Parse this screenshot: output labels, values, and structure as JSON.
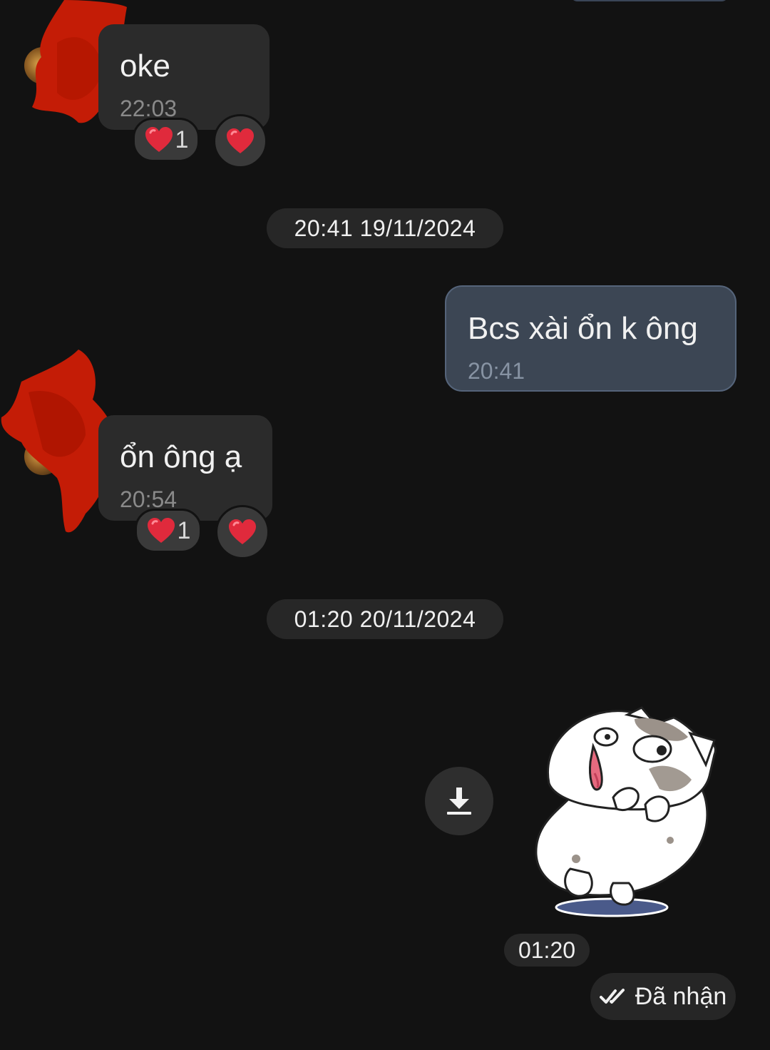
{
  "colors": {
    "background": "#121212",
    "bubble_incoming": "#2b2b2b",
    "bubble_outgoing": "#3c4654",
    "chip": "#272727",
    "reaction_heart": "#e02a3c"
  },
  "messages": [
    {
      "direction": "incoming",
      "text": "oke",
      "time": "22:03",
      "reaction": {
        "icon": "heart-icon",
        "count": "1"
      }
    },
    {
      "direction": "outgoing",
      "text": "Bcs xài ổn k ông",
      "time": "20:41"
    },
    {
      "direction": "incoming",
      "text": "ổn ông ạ",
      "time": "20:54",
      "reaction": {
        "icon": "heart-icon",
        "count": "1"
      }
    },
    {
      "direction": "outgoing",
      "type": "sticker",
      "sticker": "cat-sticker",
      "time": "01:20"
    }
  ],
  "date_separators": [
    "20:41 19/11/2024",
    "01:20 20/11/2024"
  ],
  "sticker": {
    "download_icon": "download-icon"
  },
  "status": {
    "icon": "double-check-icon",
    "label": "Đã nhận"
  }
}
